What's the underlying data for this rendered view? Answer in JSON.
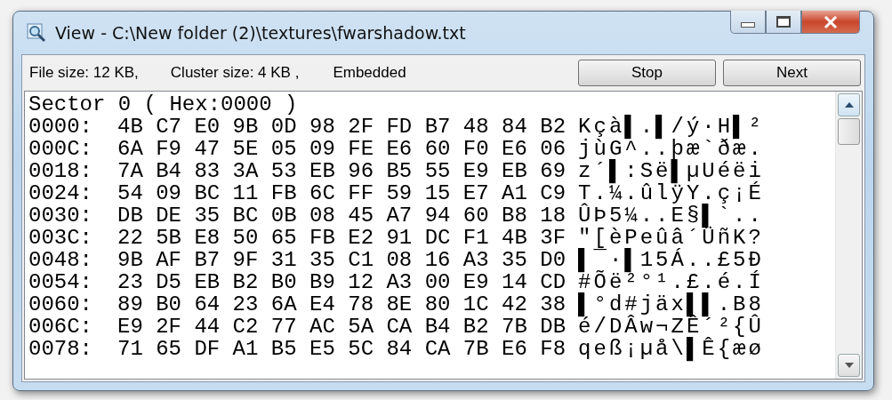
{
  "window": {
    "title": "View - C:\\New folder (2)\\textures\\fwarshadow.txt"
  },
  "info": {
    "file_size": "File size: 12 KB,",
    "cluster_size": "Cluster size: 4 KB ,",
    "mode": "Embedded"
  },
  "buttons": [
    {
      "label": "Stop"
    },
    {
      "label": "Next"
    }
  ],
  "hex_view": {
    "header": "Sector 0 ( Hex:0000 )",
    "rows": [
      {
        "offset": "0000:",
        "bytes": "4B C7 E0 9B 0D 98 2F FD B7 48 84 B2",
        "ascii": "Kçà▌.▌/ý·H▌²"
      },
      {
        "offset": "000C:",
        "bytes": "6A F9 47 5E 05 09 FE E6 60 F0 E6 06",
        "ascii": "jùG^..þæ`ðæ."
      },
      {
        "offset": "0018:",
        "bytes": "7A B4 83 3A 53 EB 96 B5 55 E9 EB 69",
        "ascii": "z´▌:Së▌µUéëi"
      },
      {
        "offset": "0024:",
        "bytes": "54 09 BC 11 FB 6C FF 59 15 E7 A1 C9",
        "ascii": "T.¼.ûlÿY.ç¡É"
      },
      {
        "offset": "0030:",
        "bytes": "DB DE 35 BC 0B 08 45 A7 94 60 B8 18",
        "ascii": "ÛÞ5¼..E§▌`.."
      },
      {
        "offset": "003C:",
        "bytes": "22 5B E8 50 65 FB E2 91 DC F1 4B 3F",
        "ascii": "\"[èPeûâ´ÜñK?"
      },
      {
        "offset": "0048:",
        "bytes": "9B AF B7 9F 31 35 C1 08 16 A3 35 D0",
        "ascii": "▌¯·▌15Á..£5Ð"
      },
      {
        "offset": "0054:",
        "bytes": "23 D5 EB B2 B0 B9 12 A3 00 E9 14 CD",
        "ascii": "#Õë²°¹.£.é.Í"
      },
      {
        "offset": "0060:",
        "bytes": "89 B0 64 23 6A E4 78 8E 80 1C 42 38",
        "ascii": "▌°d#jäx▌▌.B8"
      },
      {
        "offset": "006C:",
        "bytes": "E9 2F 44 C2 77 AC 5A CA B4 B2 7B DB",
        "ascii": "é/DÂw¬ZÊ´²{Û"
      },
      {
        "offset": "0078:",
        "bytes": "71 65 DF A1 B5 E5 5C 84 CA 7B E6 F8",
        "ascii": "qeß¡µå\\▌Ê{æø"
      }
    ]
  }
}
